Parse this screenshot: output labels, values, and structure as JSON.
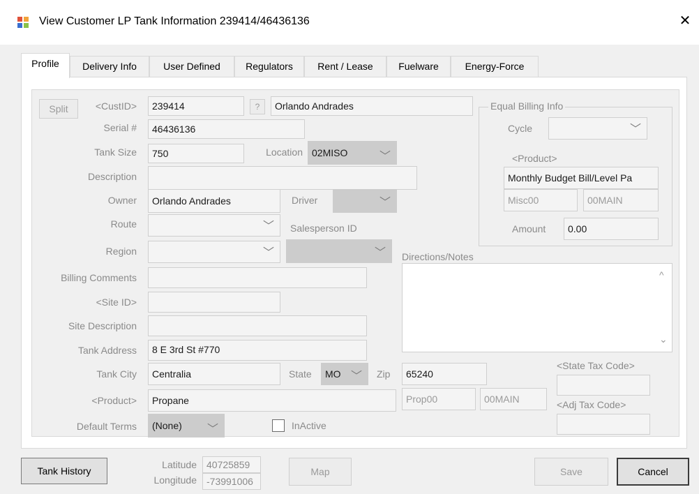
{
  "window": {
    "title": "View Customer LP Tank Information 239414/46436136",
    "close_glyph": "✕"
  },
  "tabs": [
    {
      "label": "Profile",
      "active": true
    },
    {
      "label": "Delivery Info"
    },
    {
      "label": "User Defined"
    },
    {
      "label": "Regulators"
    },
    {
      "label": "Rent / Lease"
    },
    {
      "label": "Fuelware"
    },
    {
      "label": "Energy-Force"
    }
  ],
  "profile": {
    "split_label": "Split",
    "cust_id_label": "<CustID>",
    "cust_id": "239414",
    "help_glyph": "?",
    "customer_name": "Orlando Andrades",
    "serial_label": "Serial #",
    "serial": "46436136",
    "tank_size_label": "Tank Size",
    "tank_size": "750",
    "location_label": "Location",
    "location": "02MISO",
    "description_label": "Description",
    "description": "",
    "owner_label": "Owner",
    "owner": "Orlando Andrades",
    "driver_label": "Driver",
    "driver": "",
    "route_label": "Route",
    "route": "",
    "salesperson_label": "Salesperson ID",
    "region_label": "Region",
    "region": "",
    "salesperson": "",
    "billing_comments_label": "Billing Comments",
    "billing_comments": "",
    "site_id_label": "<Site ID>",
    "site_id": "",
    "site_description_label": "Site Description",
    "site_description": "",
    "tank_address_label": "Tank Address",
    "tank_address": "8 E 3rd St #770",
    "tank_city_label": "Tank City",
    "tank_city": "Centralia",
    "state_label": "State",
    "state": "MO",
    "zip_label": "Zip",
    "zip": "65240",
    "product_label": "<Product>",
    "product": "Propane",
    "product_code": "Prop00",
    "product_dept": "00MAIN",
    "default_terms_label": "Default Terms",
    "default_terms": "(None)",
    "inactive_label": "InActive",
    "inactive_checked": false
  },
  "equal_billing": {
    "title": "Equal Billing Info",
    "cycle_label": "Cycle",
    "cycle": "",
    "product_label": "<Product>",
    "product": "Monthly Budget Bill/Level Pa",
    "misc_code": "Misc00",
    "dept": "00MAIN",
    "amount_label": "Amount",
    "amount": "0.00"
  },
  "notes": {
    "label": "Directions/Notes",
    "text": ""
  },
  "tax": {
    "state_tax_label": "<State Tax Code>",
    "state_tax": "",
    "adj_tax_label": "<Adj Tax Code>",
    "adj_tax": ""
  },
  "footer": {
    "tank_history_label": "Tank History",
    "latitude_label": "Latitude",
    "latitude": "40725859",
    "longitude_label": "Longitude",
    "longitude": "-73991006",
    "map_label": "Map",
    "save_label": "Save",
    "cancel_label": "Cancel"
  },
  "icons": {
    "chevron": "﹀",
    "scroll_up": "^",
    "scroll_down": "⌄"
  },
  "colors": {
    "window_bg": "#f0f0f0",
    "panel_bg": "#ffffff",
    "disabled_text": "#8a8a8a",
    "dark_combo": "#cccccc"
  }
}
